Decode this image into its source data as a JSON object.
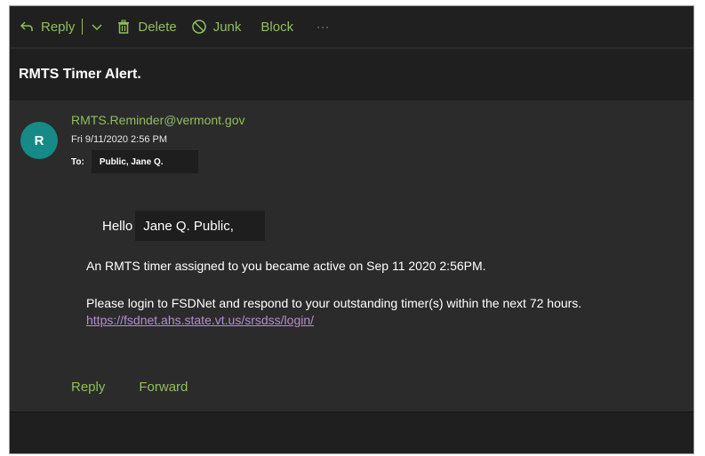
{
  "toolbar": {
    "reply_label": "Reply",
    "delete_label": "Delete",
    "junk_label": "Junk",
    "block_label": "Block",
    "more_label": "···",
    "icons": [
      "reply-icon",
      "chevron-down-icon",
      "trash-icon",
      "junk-icon",
      "more-icon"
    ],
    "accent_color": "#8fbf5a"
  },
  "email": {
    "subject": "RMTS Timer Alert.",
    "avatar_letter": "R",
    "avatar_color": "#168a86",
    "sender": "RMTS.Reminder@vermont.gov",
    "date": "Fri 9/11/2020 2:56 PM",
    "to_label": "To:",
    "to_name": "Public, Jane Q.",
    "greeting": "Hello",
    "greeting_name": "Jane Q. Public,",
    "line1": "An RMTS timer assigned to you became active on Sep 11 2020  2:56PM.",
    "line2": "Please login to FSDNet and respond to your outstanding timer(s) within the next 72 hours.",
    "link": "https://fsdnet.ahs.state.vt.us/srsdss/login/",
    "link_color": "#b98ad6"
  },
  "actions": {
    "reply_label": "Reply",
    "forward_label": "Forward"
  }
}
